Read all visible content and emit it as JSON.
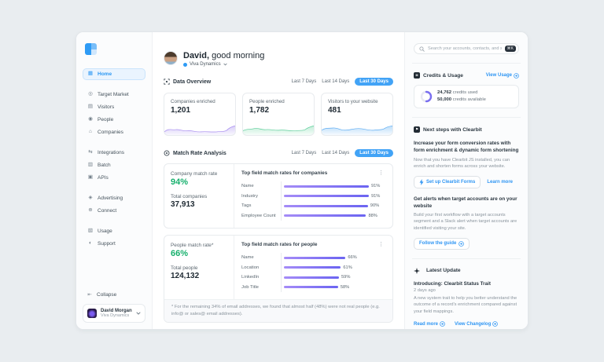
{
  "colors": {
    "accent_blue": "#2e9bf5",
    "link_blue": "#2e95f3",
    "success_green": "#17b06d",
    "bar_gradient_from": "#a58cf7",
    "bar_gradient_to": "#6b64f1",
    "spark_purple": "#b9a6f2",
    "spark_green": "#8fdfb8",
    "spark_blue": "#8ec8f7",
    "active_pill": "#42a3f6"
  },
  "icons": {
    "home": "▦",
    "target_market": "◎",
    "visitors": "▤",
    "people": "◉",
    "companies": "⌂",
    "integrations": "⇆",
    "batch": "▥",
    "apis": "▣",
    "advertising": "◈",
    "connect": "⊕",
    "usage": "▧",
    "support": "◐",
    "collapse": "⇤",
    "kebab": "⋮",
    "flag": "⚑",
    "lines": "≣"
  },
  "sidebar": {
    "groups": [
      {
        "items": [
          {
            "label": "Home"
          }
        ]
      },
      {
        "items": [
          {
            "label": "Target Market"
          },
          {
            "label": "Visitors"
          },
          {
            "label": "People"
          },
          {
            "label": "Companies"
          }
        ]
      },
      {
        "items": [
          {
            "label": "Integrations"
          },
          {
            "label": "Batch"
          },
          {
            "label": "APIs"
          }
        ]
      },
      {
        "items": [
          {
            "label": "Advertising"
          },
          {
            "label": "Connect"
          }
        ]
      },
      {
        "items": [
          {
            "label": "Usage"
          },
          {
            "label": "Support"
          }
        ]
      }
    ],
    "collapse_label": "Collapse",
    "user": {
      "name": "David Morgan",
      "company": "Viva Dynamics"
    }
  },
  "header": {
    "name_bold": "David,",
    "greeting": " good morning",
    "workspace": "Viva Dynamics"
  },
  "period_tabs": {
    "tab1": "Last 7 Days",
    "tab2": "Last 14 Days",
    "tab3": "Last 30 Days"
  },
  "data_overview": {
    "title": "Data Overview",
    "cards": [
      {
        "label": "Companies enriched",
        "value": "1,201"
      },
      {
        "label": "People enriched",
        "value": "1,782"
      },
      {
        "label": "Visitors to your website",
        "value": "481"
      }
    ]
  },
  "match_rate": {
    "title": "Match Rate Analysis",
    "company": {
      "rate_label": "Company match rate",
      "rate": "94%",
      "total_label": "Total companies",
      "total": "37,913",
      "chart_title": "Top field match rates for companies",
      "rows": [
        {
          "label": "Name",
          "pct": 91,
          "pct_label": "91%"
        },
        {
          "label": "Industry",
          "pct": 91,
          "pct_label": "91%"
        },
        {
          "label": "Tags",
          "pct": 90,
          "pct_label": "90%"
        },
        {
          "label": "Employee Count",
          "pct": 88,
          "pct_label": "88%"
        }
      ]
    },
    "people": {
      "rate_label": "People match rate*",
      "rate": "66%",
      "total_label": "Total people",
      "total": "124,132",
      "chart_title": "Top field match rates for people",
      "rows": [
        {
          "label": "Name",
          "pct": 66,
          "pct_label": "66%"
        },
        {
          "label": "Location",
          "pct": 61,
          "pct_label": "61%"
        },
        {
          "label": "LinkedIn",
          "pct": 59,
          "pct_label": "59%"
        },
        {
          "label": "Job Title",
          "pct": 58,
          "pct_label": "58%"
        }
      ]
    },
    "footnote": "* For the remaining 34% of email addresses, we found that almost half (48%) were not real people (e.g. info@ or sales@ email addresses)."
  },
  "right_panel": {
    "search_placeholder": "Search your accounts, contacts, and segments",
    "search_shortcut": "⌘K",
    "credits": {
      "title": "Credits & Usage",
      "link": "View Usage",
      "used_value": "24,762",
      "used_suffix": " credits used",
      "available_value": "50,000",
      "available_suffix": " credits available",
      "used_pct": 49.5
    },
    "next_steps": {
      "title": "Next steps with Clearbit",
      "item1_title": "Increase your form conversion rates with form enrichment & dynamic form shortening",
      "item1_body": "Now that you have Clearbit JS installed, you can enrich and shorten forms across your website.",
      "item1_button": "Set up Clearbit Forms",
      "item1_link": "Learn more",
      "item2_title": "Get alerts when target accounts are on your website",
      "item2_body": "Build your first workflow with a target accounts segment and a Slack alert when target accounts are identified visiting your site.",
      "item2_button": "Follow the guide"
    },
    "latest_update": {
      "title": "Latest Update",
      "post_title": "Introducing: Clearbit Status Trait",
      "post_time": "2 days ago",
      "post_body": "A new system trait to help you better understand the outcome of a record's enrichment compared against your field mappings.",
      "read_more": "Read more",
      "view_changelog": "View Changelog"
    }
  }
}
